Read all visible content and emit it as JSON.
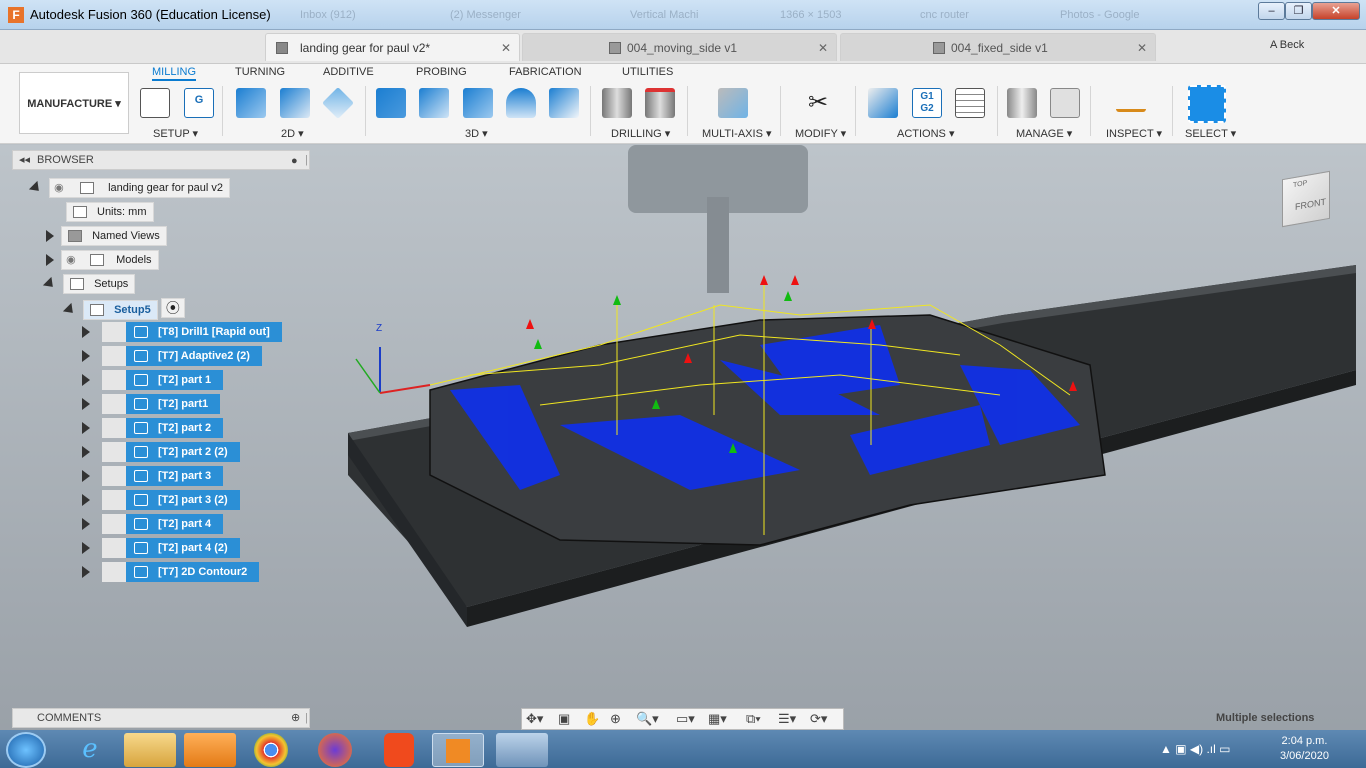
{
  "window": {
    "title": "Autodesk Fusion 360 (Education License)",
    "icon": "F",
    "controls": [
      "–",
      "❐",
      "✕"
    ],
    "ghost_tabs": [
      "Inbox (912)",
      "(2) Messenger",
      "Vertical Machi",
      "1366 × 1503",
      "cnc router",
      "Photos - Google"
    ]
  },
  "doc_tabs": [
    {
      "label": "landing gear for paul v2*",
      "active": true
    },
    {
      "label": "004_moving_side v1",
      "active": false
    },
    {
      "label": "004_fixed_side v1",
      "active": false
    }
  ],
  "user": "A Beck",
  "ribbon": {
    "workspace": "MANUFACTURE",
    "tabs": [
      "MILLING",
      "TURNING",
      "ADDITIVE",
      "PROBING",
      "FABRICATION",
      "UTILITIES"
    ],
    "groups": [
      "SETUP",
      "2D",
      "3D",
      "DRILLING",
      "MULTI-AXIS",
      "MODIFY",
      "ACTIONS",
      "MANAGE",
      "INSPECT",
      "SELECT"
    ],
    "actions_icon_text": "G1\nG2",
    "setup_icon_text": "G"
  },
  "browser": {
    "title": "BROWSER",
    "root": "landing gear for paul v2",
    "units": "Units: mm",
    "named_views": "Named Views",
    "models": "Models",
    "setups": "Setups",
    "setup": "Setup5",
    "operations": [
      "[T8] Drill1 [Rapid out]",
      "[T7] Adaptive2 (2)",
      "[T2] part 1",
      "[T2] part1",
      "[T2] part 2",
      "[T2] part 2 (2)",
      "[T2] part 3",
      "[T2] part 3 (2)",
      "[T2] part 4",
      "[T2] part 4 (2)",
      "[T7] 2D Contour2"
    ]
  },
  "viewcube": {
    "label": "FRONT",
    "top": "TOP"
  },
  "triad": {
    "z": "Z"
  },
  "comments": "COMMENTS",
  "status": "Multiple selections",
  "clock": {
    "time": "2:04 p.m.",
    "date": "3/06/2020"
  }
}
